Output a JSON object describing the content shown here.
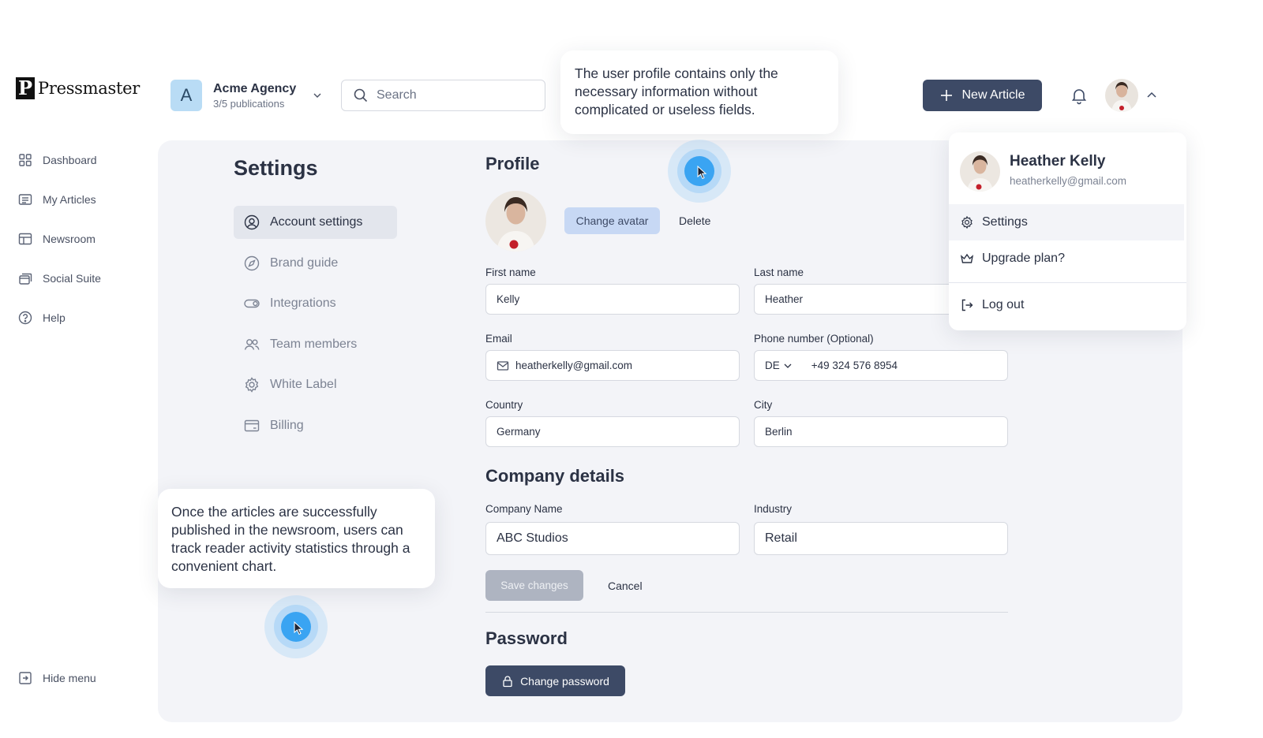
{
  "brand": {
    "logo_letter": "P",
    "name": "Pressmaster"
  },
  "nav": {
    "items": [
      {
        "label": "Dashboard",
        "icon": "grid-icon"
      },
      {
        "label": "My Articles",
        "icon": "articles-icon"
      },
      {
        "label": "Newsroom",
        "icon": "layout-icon"
      },
      {
        "label": "Social Suite",
        "icon": "stack-icon"
      },
      {
        "label": "Help",
        "icon": "help-icon"
      }
    ],
    "hide_menu": "Hide menu"
  },
  "agency": {
    "initial": "A",
    "name": "Acme Agency",
    "sub": "3/5 publications"
  },
  "search": {
    "placeholder": "Search"
  },
  "header": {
    "new_article": "New Article"
  },
  "tooltips": {
    "top": "The user profile contains only the necessary information without complicated or useless fields.",
    "bottom": "Once the articles are successfully published in the newsroom, users can track reader activity statistics through a convenient chart."
  },
  "settings": {
    "title": "Settings",
    "menu": [
      {
        "label": "Account settings",
        "icon": "user-circle-icon",
        "active": true
      },
      {
        "label": "Brand guide",
        "icon": "compass-icon"
      },
      {
        "label": "Integrations",
        "icon": "toggle-icon"
      },
      {
        "label": "Team members",
        "icon": "users-icon"
      },
      {
        "label": "White Label",
        "icon": "gear-icon"
      },
      {
        "label": "Billing",
        "icon": "card-icon"
      }
    ]
  },
  "profile": {
    "heading": "Profile",
    "change_avatar": "Change avatar",
    "delete": "Delete",
    "first_name_label": "First name",
    "first_name": "Kelly",
    "last_name_label": "Last name",
    "last_name": "Heather",
    "email_label": "Email",
    "email": "heatherkelly@gmail.com",
    "phone_label": "Phone number (Optional)",
    "phone_country": "DE",
    "phone": "+49 324 576 8954",
    "country_label": "Country",
    "country": "Germany",
    "city_label": "City",
    "city": "Berlin"
  },
  "company": {
    "heading": "Company details",
    "name_label": "Company Name",
    "name": "ABC Studios",
    "industry_label": "Industry",
    "industry": "Retail",
    "save": "Save changes",
    "cancel": "Cancel"
  },
  "password": {
    "heading": "Password",
    "change": "Change password"
  },
  "user_menu": {
    "name": "Heather Kelly",
    "email": "heatherkelly@gmail.com",
    "items": [
      {
        "label": "Settings",
        "icon": "gear-icon",
        "active": true
      },
      {
        "label": "Upgrade plan?",
        "icon": "crown-icon"
      },
      {
        "label": "Log out",
        "icon": "logout-icon"
      }
    ]
  },
  "colors": {
    "primary": "#3d4a66",
    "accent_blue": "#3aa4f2",
    "panel_bg": "#f3f4f8"
  }
}
